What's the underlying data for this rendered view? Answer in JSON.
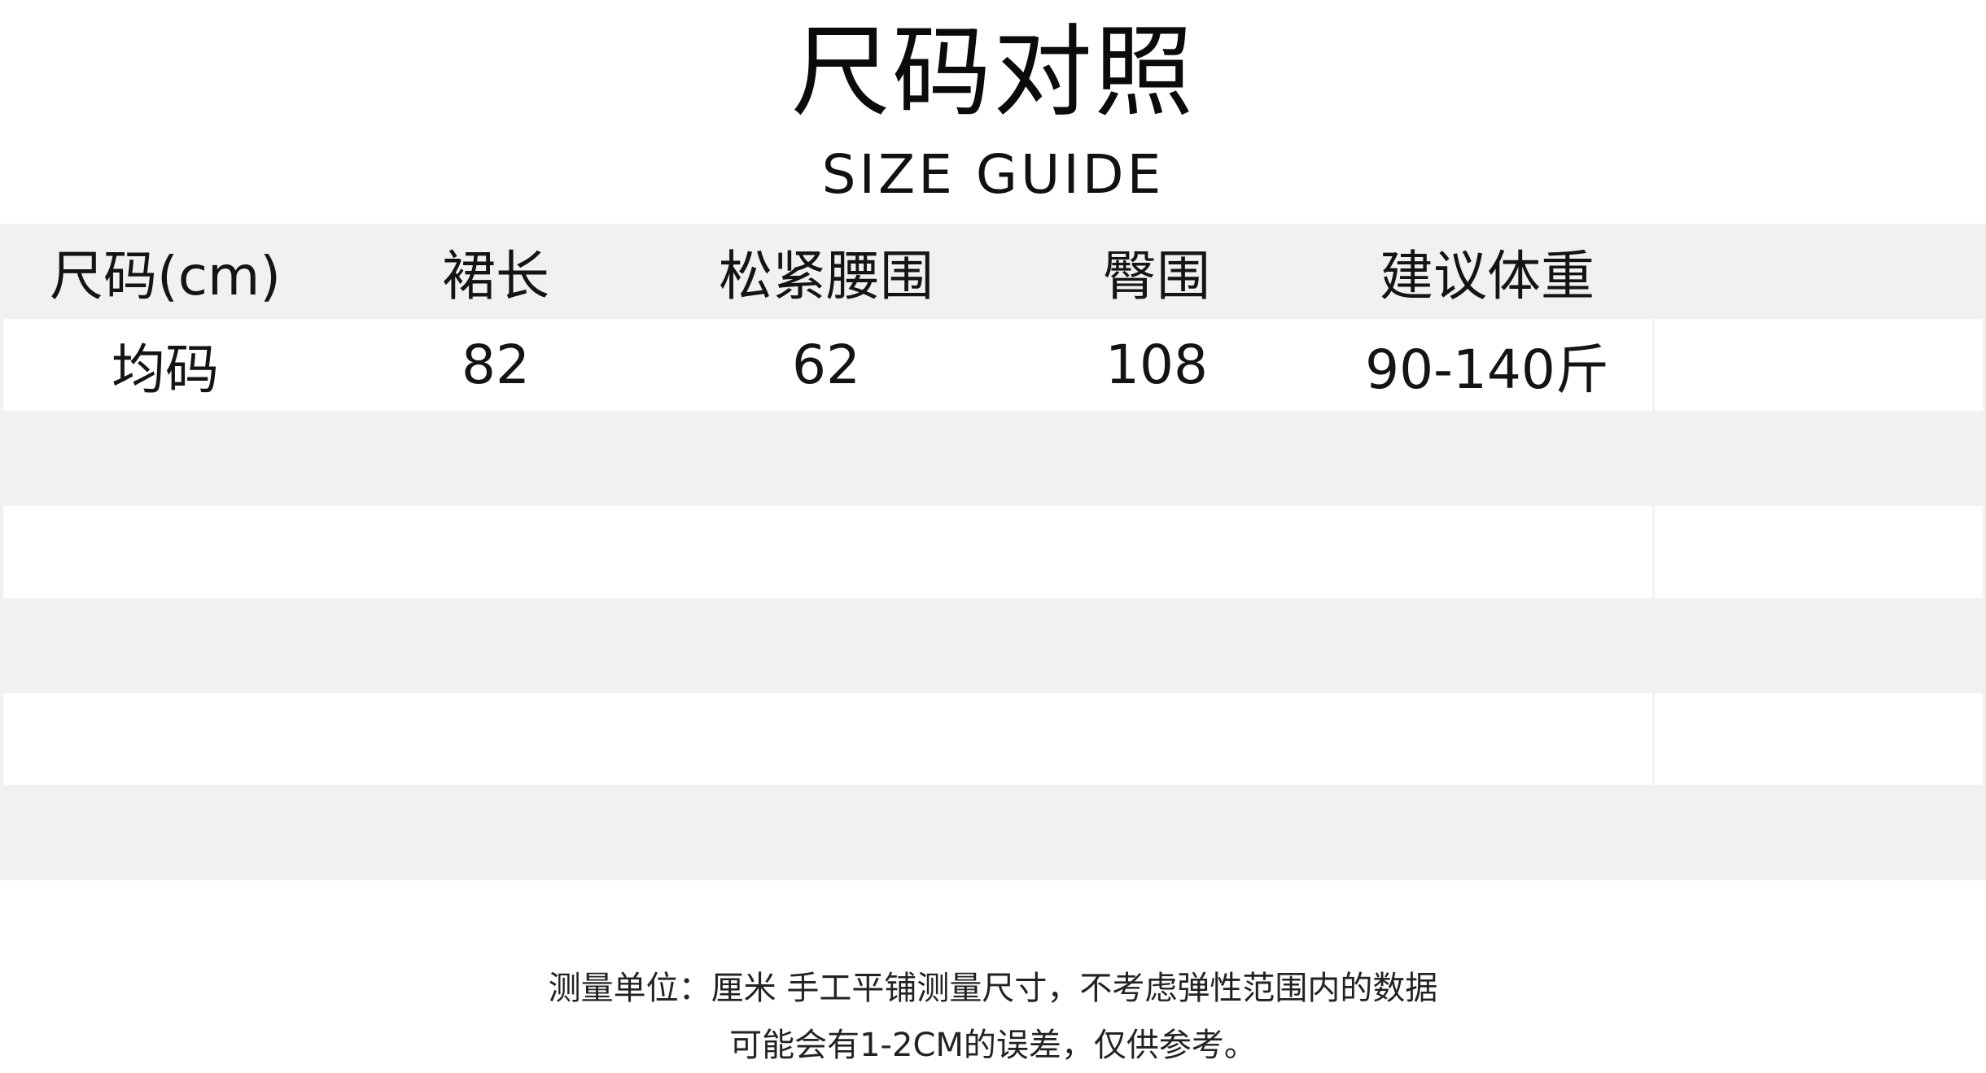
{
  "title": "尺码对照",
  "subtitle": "SIZE GUIDE",
  "table": {
    "headers": [
      "尺码(cm)",
      "裙长",
      "松紧腰围",
      "臀围",
      "建议体重"
    ],
    "rows": [
      [
        "均码",
        "82",
        "62",
        "108",
        "90-140斤"
      ]
    ]
  },
  "notes": {
    "line1": "测量单位：厘米 手工平铺测量尺寸，不考虑弹性范围内的数据",
    "line2": "可能会有1-2CM的误差，仅供参考。"
  },
  "colors": {
    "shaded_row": "#f1f1f1",
    "white_row": "#ffffff",
    "text": "#111111"
  }
}
